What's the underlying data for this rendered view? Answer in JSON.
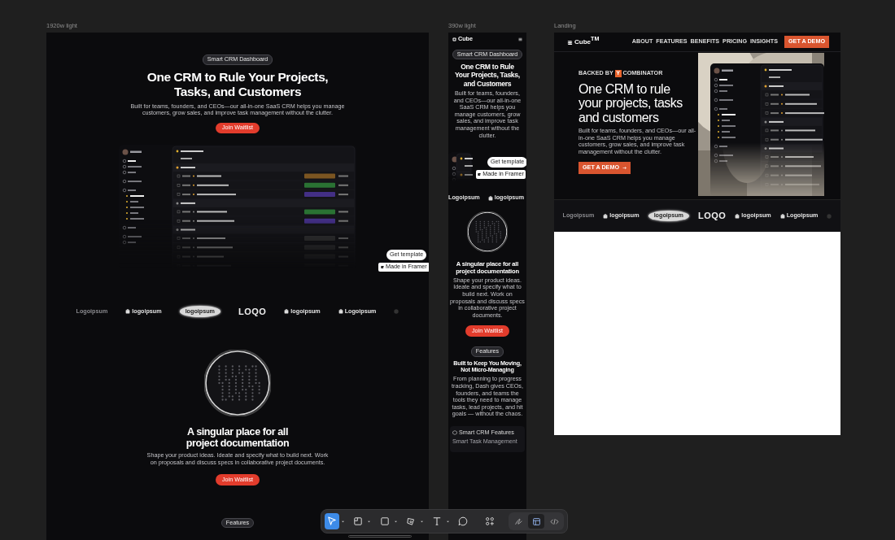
{
  "desktop": {
    "label": "1920w light",
    "badge": "Smart CRM Dashboard",
    "heading": "One CRM to Rule Your Projects, Tasks, and Customers",
    "intro": "Built for teams, founders, and CEOs—our all-in-one SaaS CRM helps you manage customers, grow sales, and improve task management without the clutter.",
    "cta": "Join Waitlist",
    "template_button": "Get template",
    "framer_badge": "Made in Framer",
    "logos": [
      {
        "kind": "faded",
        "label": "Logoipsum"
      },
      {
        "kind": "icon-text",
        "label": "logoipsum"
      },
      {
        "kind": "oval",
        "label": "logoipsum"
      },
      {
        "kind": "wordmark",
        "label": "LOQO"
      },
      {
        "kind": "icon-text",
        "label": "logoipsum"
      },
      {
        "kind": "icon-text",
        "label": "Logoipsum"
      },
      {
        "kind": "faded-icon"
      }
    ],
    "feature_heading": "A singular place for all project documentation",
    "feature_text": "Shape your product ideas. Ideate and specify what to build next. Work on proposals and discuss specs in collaborative project documents.",
    "feature_cta": "Join Waitlist",
    "next_badge": "Features"
  },
  "mobile": {
    "label": "390w light",
    "brand": "Cube",
    "badge": "Smart CRM Dashboard",
    "heading": "One CRM to Rule Your Projects, Tasks, and Customers",
    "intro": "Built for teams, founders, and CEOs—our all-in-one SaaS CRM helps you manage customers, grow sales, and improve task management without the clutter.",
    "template_button": "Get template",
    "framer_badge": "Made in Framer",
    "logos": [
      {
        "kind": "text",
        "label": "Logoipsum"
      },
      {
        "kind": "icon-text",
        "label": "logoipsum"
      }
    ],
    "feature_heading": "A singular place for all project documentation",
    "feature_text": "Shape your product ideas. Ideate and specify what to build next. Work on proposals and discuss specs in collaborative project documents.",
    "feature_cta": "Join Waitlist",
    "next_badge": "Features",
    "next_heading": "Built to Keep You Moving, Not Micro-Managing",
    "next_text": "From planning to progress tracking, Dash gives CEOs, founders, and teams the tools they need to manage tasks, lead projects, and hit goals — without the chaos.",
    "card_title": "Smart CRM Features",
    "card_text": "Smart Task Management"
  },
  "landing": {
    "label": "Landing",
    "brand": "Cube$^{TM}$",
    "links": [
      "ABOUT",
      "FEATURES",
      "BENEFITS",
      "PRICING",
      "INSIGHTS"
    ],
    "demo": "GET A DEMO",
    "backed": "BACKED BY",
    "yc": "Y",
    "combinator": "COMBINATOR",
    "heading": "One CRM to rule your projects, tasks and customers",
    "intro": "Built for teams, founders, and CEOs—our all-in-one SaaS CRM helps you manage customers, grow sales, and improve task management without the clutter.",
    "cta": "GET A DEMO",
    "logos": [
      {
        "kind": "faded",
        "label": "Logoipsum"
      },
      {
        "kind": "icon-text",
        "label": "logoipsum"
      },
      {
        "kind": "oval",
        "label": "logoipsum"
      },
      {
        "kind": "wordmark",
        "label": "LOQO"
      },
      {
        "kind": "icon-text",
        "label": "logoipsum"
      },
      {
        "kind": "icon-text",
        "label": "Logoipsum"
      },
      {
        "kind": "faded-icon"
      }
    ]
  },
  "toolbar": {
    "tools": [
      {
        "kind": "move",
        "selected": true,
        "menu": true
      },
      {
        "kind": "frame",
        "selected": false,
        "menu": true
      },
      {
        "kind": "rect",
        "selected": false,
        "menu": true
      },
      {
        "kind": "pen",
        "selected": false,
        "menu": true
      },
      {
        "kind": "text",
        "selected": false,
        "menu": true
      },
      {
        "kind": "comment",
        "selected": false,
        "menu": false
      },
      {
        "kind": "components",
        "selected": false,
        "menu": false
      }
    ],
    "modes": [
      {
        "kind": "draw",
        "selected": false
      },
      {
        "kind": "design",
        "selected": true
      },
      {
        "kind": "dev",
        "selected": false
      }
    ]
  }
}
